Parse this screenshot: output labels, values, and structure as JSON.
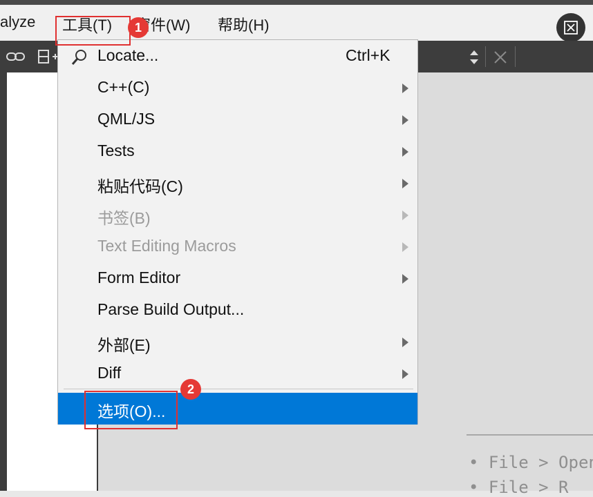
{
  "menubar": {
    "analyze_partial": "alyze",
    "tools": "工具(T)",
    "window": "窗件(W)",
    "help": "帮助(H)"
  },
  "tools_menu": {
    "items": [
      {
        "label": "Locate...",
        "shortcut": "Ctrl+K",
        "icon": "search-icon"
      },
      {
        "label": "C++(C)",
        "submenu": true
      },
      {
        "label": "QML/JS",
        "submenu": true
      },
      {
        "label": "Tests",
        "submenu": true
      },
      {
        "label": "粘贴代码(C)",
        "submenu": true
      },
      {
        "label": "书签(B)",
        "submenu": true,
        "disabled": true
      },
      {
        "label": "Text Editing Macros",
        "submenu": true,
        "disabled": true
      },
      {
        "label": "Form Editor",
        "submenu": true
      },
      {
        "label": "Parse Build Output..."
      },
      {
        "label": "外部(E)",
        "submenu": true
      },
      {
        "label": "Diff",
        "submenu": true
      },
      {
        "label": "选项(O)...",
        "selected": true
      }
    ]
  },
  "annotations": {
    "badge1": "1",
    "badge2": "2"
  },
  "editor_hints": {
    "line1": "• File > Open",
    "line2": "• File > R"
  },
  "colors": {
    "highlight": "#0078d7",
    "annotation": "#e03030"
  }
}
